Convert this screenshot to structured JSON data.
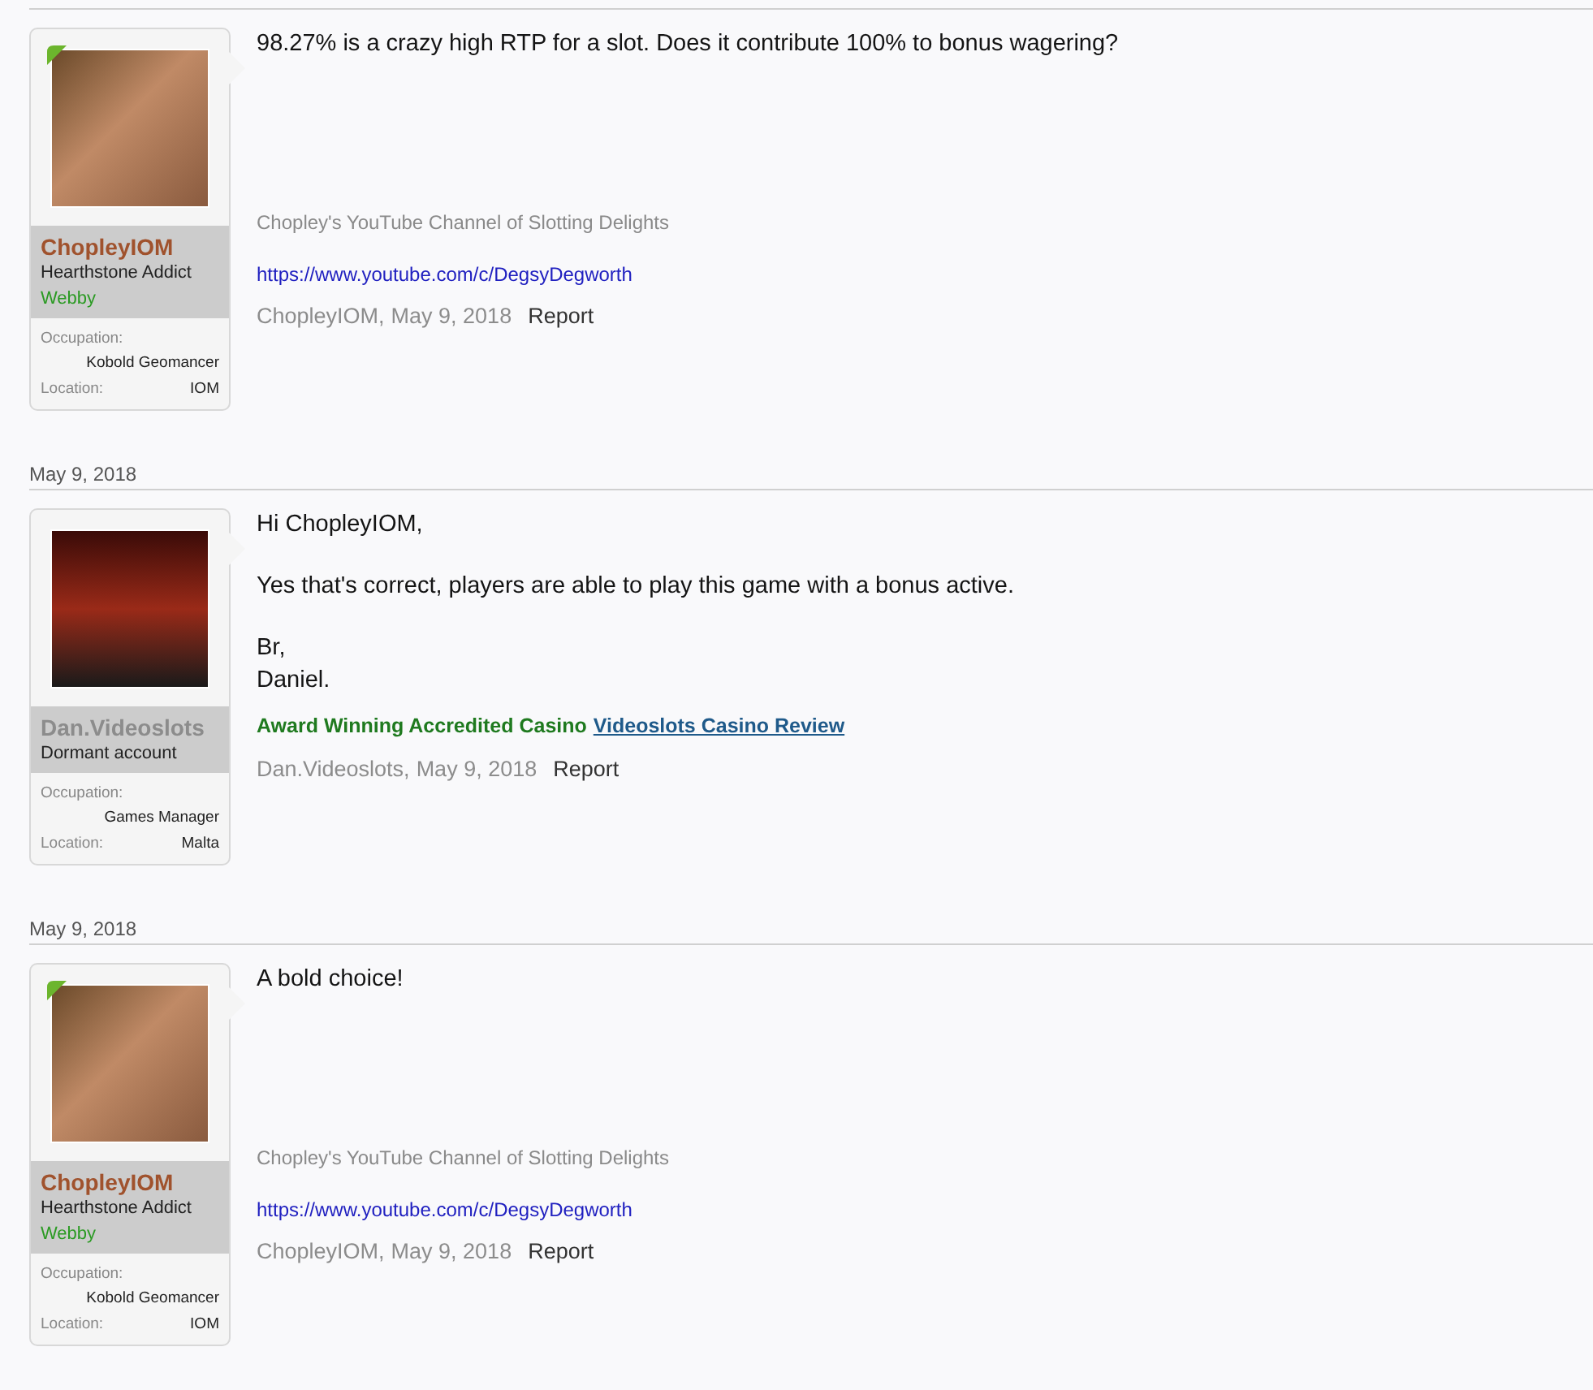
{
  "posts": [
    {
      "author": {
        "name": "ChopleyIOM",
        "color": "#a0522d",
        "title": "Hearthstone Addict",
        "banner": "Webby",
        "online": true
      },
      "fields": [
        {
          "label": "Occupation:",
          "value": "Kobold Geomancer"
        },
        {
          "label": "Location:",
          "value": "IOM"
        }
      ],
      "paragraphs": [
        "98.27% is a crazy high RTP for a slot. Does it contribute 100% to bonus wagering?"
      ],
      "signature": {
        "kind": "channel",
        "title": "Chopley's YouTube Channel of Slotting Delights",
        "link": "https://www.youtube.com/c/DegsyDegworth"
      },
      "footer": {
        "author": "ChopleyIOM,",
        "date": "May 9, 2018",
        "report": "Report"
      }
    },
    {
      "date": "May 9, 2018",
      "author": {
        "name": "Dan.Videoslots",
        "color": "#8c8c8c",
        "title": "Dormant account",
        "online": false
      },
      "fields": [
        {
          "label": "Occupation:",
          "value": "Games Manager"
        },
        {
          "label": "Location:",
          "value": "Malta"
        }
      ],
      "paragraphs": [
        "Hi ChopleyIOM,",
        "Yes that's correct, players are able to play this game with a bonus active.",
        "Br,\nDaniel."
      ],
      "signature": {
        "kind": "award",
        "text": "Award Winning Accredited Casino",
        "link": "Videoslots Casino Review"
      },
      "footer": {
        "author": "Dan.Videoslots,",
        "date": "May 9, 2018",
        "report": "Report"
      }
    },
    {
      "date": "May 9, 2018",
      "author": {
        "name": "ChopleyIOM",
        "color": "#a0522d",
        "title": "Hearthstone Addict",
        "banner": "Webby",
        "online": true
      },
      "fields": [
        {
          "label": "Occupation:",
          "value": "Kobold Geomancer"
        },
        {
          "label": "Location:",
          "value": "IOM"
        }
      ],
      "paragraphs": [
        "A bold choice!"
      ],
      "signature": {
        "kind": "channel",
        "title": "Chopley's YouTube Channel of Slotting Delights",
        "link": "https://www.youtube.com/c/DegsyDegworth"
      },
      "footer": {
        "author": "ChopleyIOM,",
        "date": "May 9, 2018",
        "report": "Report"
      }
    }
  ]
}
